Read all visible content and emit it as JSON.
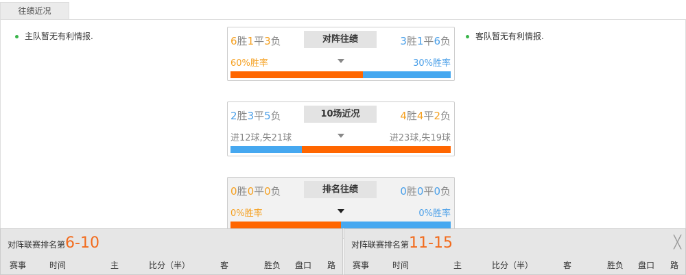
{
  "tab": "往绩近况",
  "home_note": "主队暂无有利情报.",
  "away_note": "客队暂无有利情报.",
  "colors": {
    "orange_text": "#f5a020",
    "blue_text": "#4a9fe8",
    "orange_bar": "#ff6600",
    "blue_bar": "#46a8f0"
  },
  "h2h": {
    "title": "对阵往绩",
    "left": {
      "w": "6",
      "d": "1",
      "l": "3"
    },
    "right": {
      "w": "3",
      "d": "1",
      "l": "6"
    },
    "left_rate": "60%胜率",
    "right_rate": "30%胜率",
    "left_pct": 60,
    "right_pct": 40
  },
  "recent": {
    "title": "10场近况",
    "left": {
      "w": "2",
      "d": "3",
      "l": "5"
    },
    "right": {
      "w": "4",
      "d": "4",
      "l": "2"
    },
    "left_goals": "进12球,失21球",
    "right_goals": "进23球,失19球",
    "left_pct": 32.5,
    "right_pct": 67.5
  },
  "rank": {
    "title": "排名往绩",
    "left": {
      "w": "0",
      "d": "0",
      "l": "0"
    },
    "right": {
      "w": "0",
      "d": "0",
      "l": "0"
    },
    "left_rate": "0%胜率",
    "right_rate": "0%胜率",
    "left_pct": 50,
    "right_pct": 50
  },
  "labels": {
    "win": "胜",
    "draw": "平",
    "loss": "负"
  },
  "panels": [
    {
      "prefix": "对阵联赛排名第",
      "range": "6-10"
    },
    {
      "prefix": "对阵联赛排名第",
      "range": "11-15"
    }
  ],
  "columns": [
    "赛事",
    "时间",
    "主",
    "比分（半）",
    "客",
    "胜负",
    "盘口",
    "路"
  ],
  "close": "╳"
}
